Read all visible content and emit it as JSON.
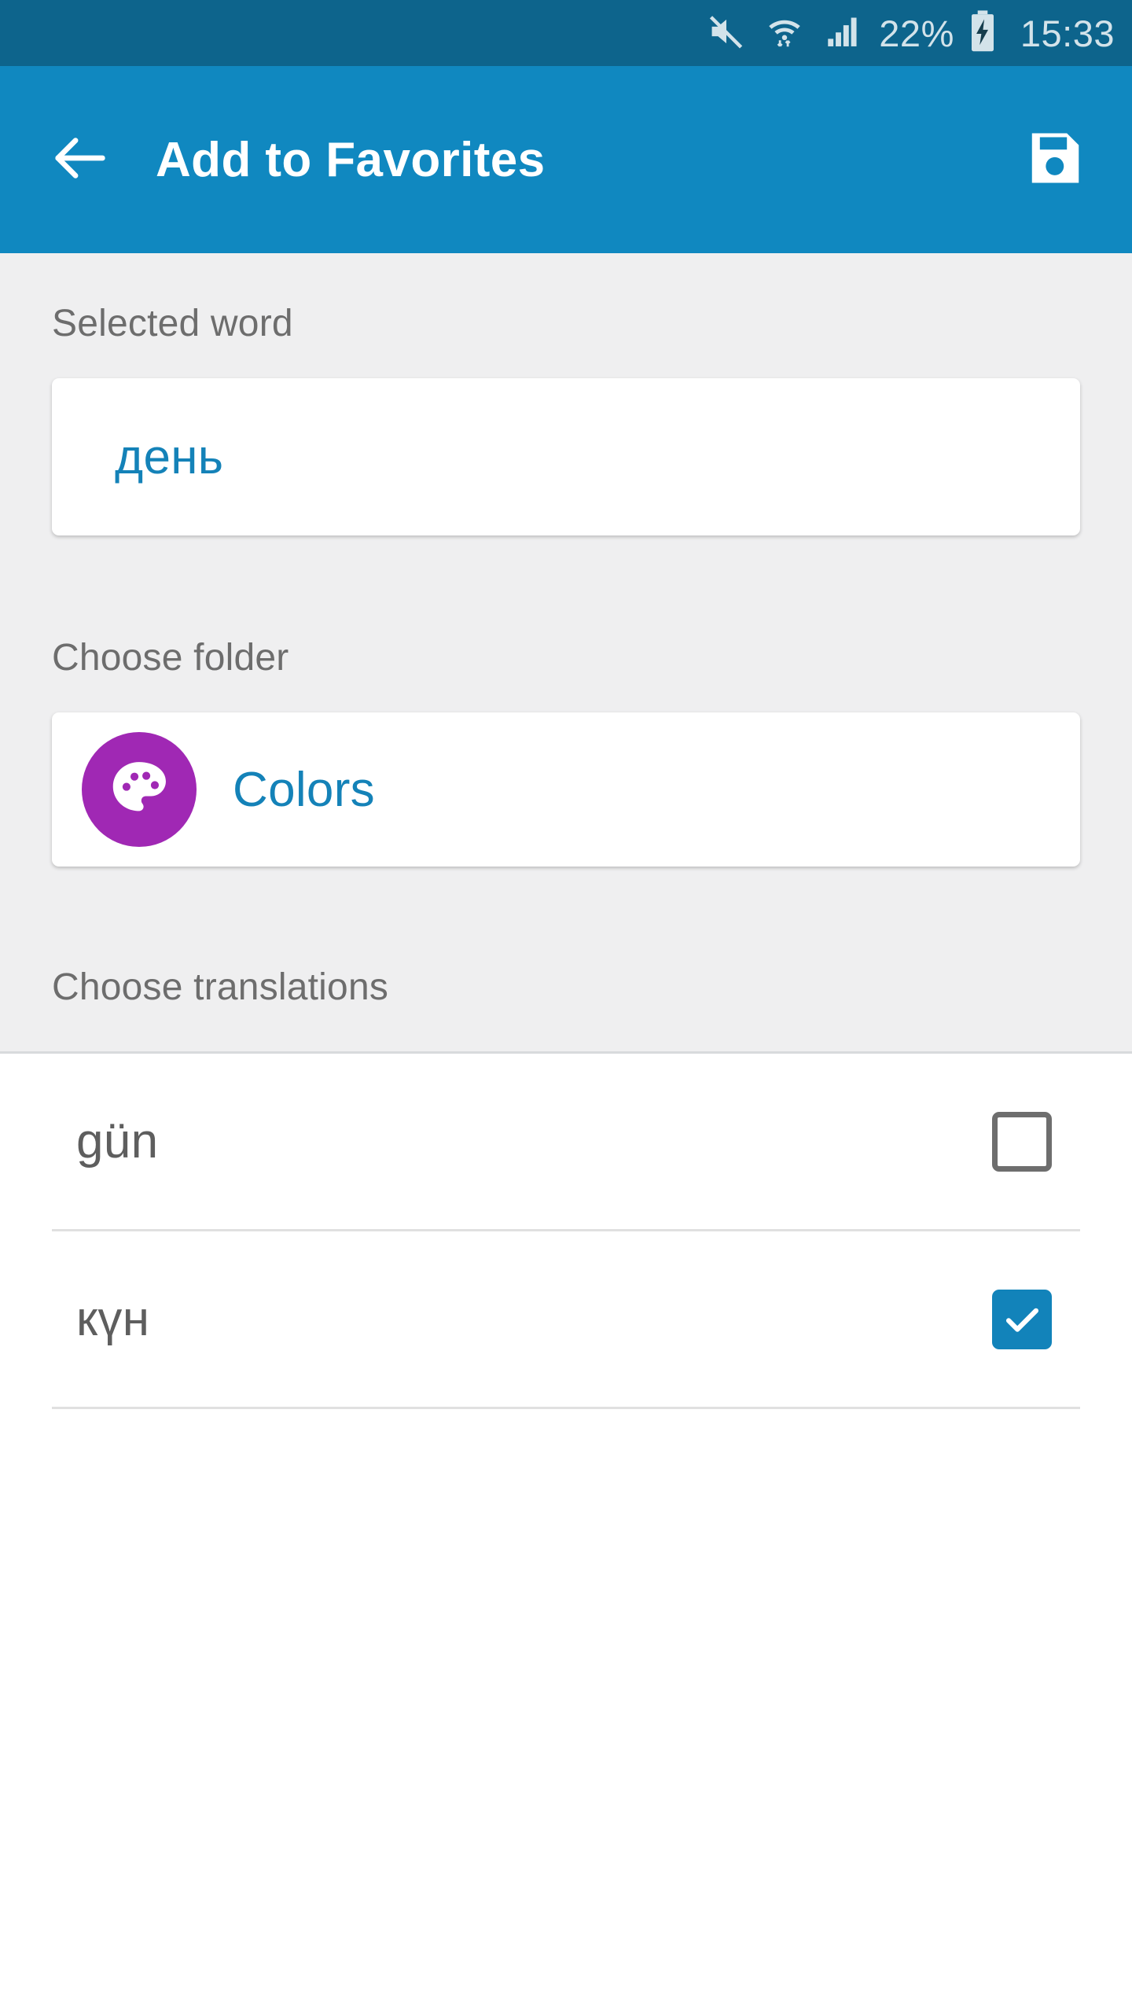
{
  "status_bar": {
    "background": "#0d648c",
    "mute_icon": "mute-icon",
    "wifi_icon": "wifi-icon",
    "signal_icon": "signal-bars-icon",
    "battery_percent": "22%",
    "battery_icon": "battery-charging-icon",
    "clock": "15:33"
  },
  "app_bar": {
    "background": "#1088c0",
    "back_icon": "back-arrow-icon",
    "title": "Add to Favorites",
    "save_icon": "save-floppy-icon"
  },
  "selected_word": {
    "label": "Selected word",
    "value": "день",
    "value_color": "#1482b8"
  },
  "folder": {
    "label": "Choose folder",
    "name": "Colors",
    "avatar_icon": "palette-icon",
    "avatar_color": "#a028b4",
    "name_color": "#1482b8"
  },
  "translations": {
    "label": "Choose translations",
    "items": [
      {
        "text": "gün",
        "checked": false
      },
      {
        "text": "күн",
        "checked": true
      }
    ],
    "checked_color": "#1283ba",
    "unchecked_color": "#6e6e6e"
  },
  "theme": {
    "page_background": "#efeff0",
    "list_background": "#ffffff",
    "label_color": "#6d6d6d",
    "divider_color": "#e0e0e0"
  }
}
